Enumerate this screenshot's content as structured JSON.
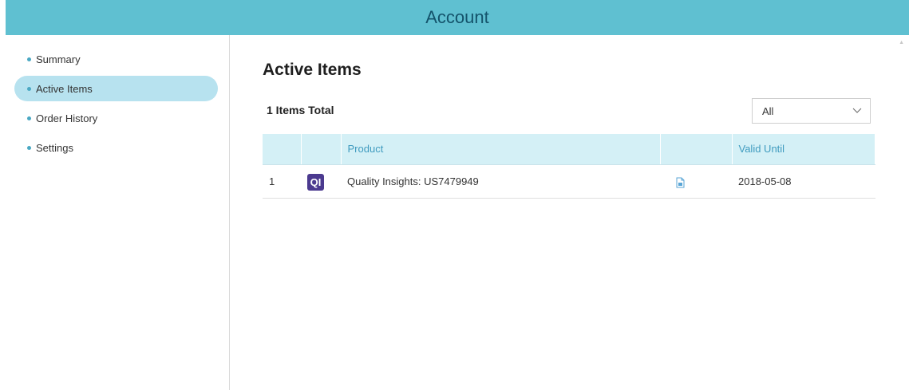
{
  "header": {
    "title": "Account"
  },
  "sidebar": {
    "items": [
      {
        "label": "Summary",
        "active": false
      },
      {
        "label": "Active Items",
        "active": true
      },
      {
        "label": "Order History",
        "active": false
      },
      {
        "label": "Settings",
        "active": false
      }
    ]
  },
  "main": {
    "title": "Active Items",
    "total_label": "1 Items Total",
    "filter": {
      "selected": "All"
    },
    "table": {
      "headers": [
        "",
        "",
        "Product",
        "",
        "Valid Until"
      ],
      "rows": [
        {
          "index": "1",
          "badge": "QI",
          "product": "Quality Insights: US7479949",
          "doc_icon": "document-icon",
          "valid_until": "2018-05-08"
        }
      ]
    }
  },
  "colors": {
    "header_bg": "#5fc0d1",
    "active_item_bg": "#b7e2ef",
    "table_header_bg": "#d4f0f6",
    "badge_bg": "#4b3a8f",
    "accent_text": "#3f9bbf"
  },
  "icons": {
    "bullet": "bullet-dot-icon",
    "dropdown": "chevron-down-icon",
    "document": "document-icon",
    "scroll_up": "scroll-up-arrow-icon"
  }
}
